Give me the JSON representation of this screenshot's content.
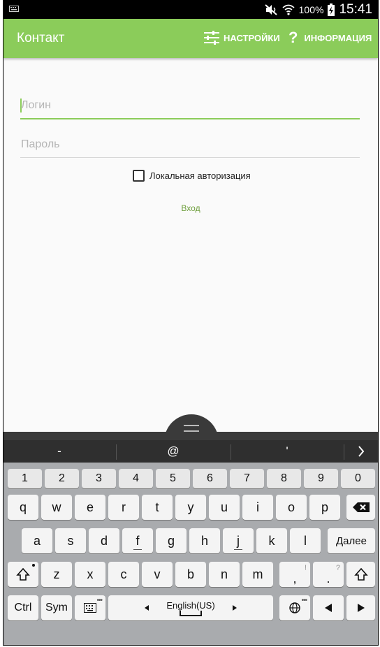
{
  "status_bar": {
    "battery_pct": "100%",
    "time": "15:41"
  },
  "app_bar": {
    "title": "Контакт",
    "settings_label": "НАСТРОЙКИ",
    "info_label": "ИНФОРМАЦИЯ",
    "info_icon": "?"
  },
  "form": {
    "login_placeholder": "Логин",
    "password_placeholder": "Пароль",
    "local_auth_label": "Локальная авторизация",
    "local_auth_checked": false,
    "login_button": "Вход"
  },
  "keyboard": {
    "suggestions": [
      "-",
      "@",
      "'"
    ],
    "row_numbers": [
      "1",
      "2",
      "3",
      "4",
      "5",
      "6",
      "7",
      "8",
      "9",
      "0"
    ],
    "row_top": [
      "q",
      "w",
      "e",
      "r",
      "t",
      "y",
      "u",
      "i",
      "o",
      "p"
    ],
    "row_home": [
      "a",
      "s",
      "d",
      "f",
      "g",
      "h",
      "j",
      "k",
      "l"
    ],
    "enter_label": "Далее",
    "row_bottom": [
      "z",
      "x",
      "c",
      "v",
      "b",
      "n",
      "m"
    ],
    "comma_key": ",",
    "comma_hint": "!",
    "period_key": ".",
    "period_hint": "?",
    "ctrl_label": "Ctrl",
    "sym_label": "Sym",
    "space_label": "English(US)"
  },
  "colors": {
    "accent": "#8bcc5a",
    "link": "#6f9f3e",
    "keyboard_bg": "#a9abae"
  },
  "icons": [
    "keyboard-icon",
    "mute-icon",
    "wifi-icon",
    "battery-charging-icon",
    "settings-sliders-icon",
    "help-icon",
    "backspace-icon",
    "shift-icon",
    "keyboard-settings-icon",
    "globe-icon",
    "arrow-left-icon",
    "arrow-right-icon"
  ]
}
